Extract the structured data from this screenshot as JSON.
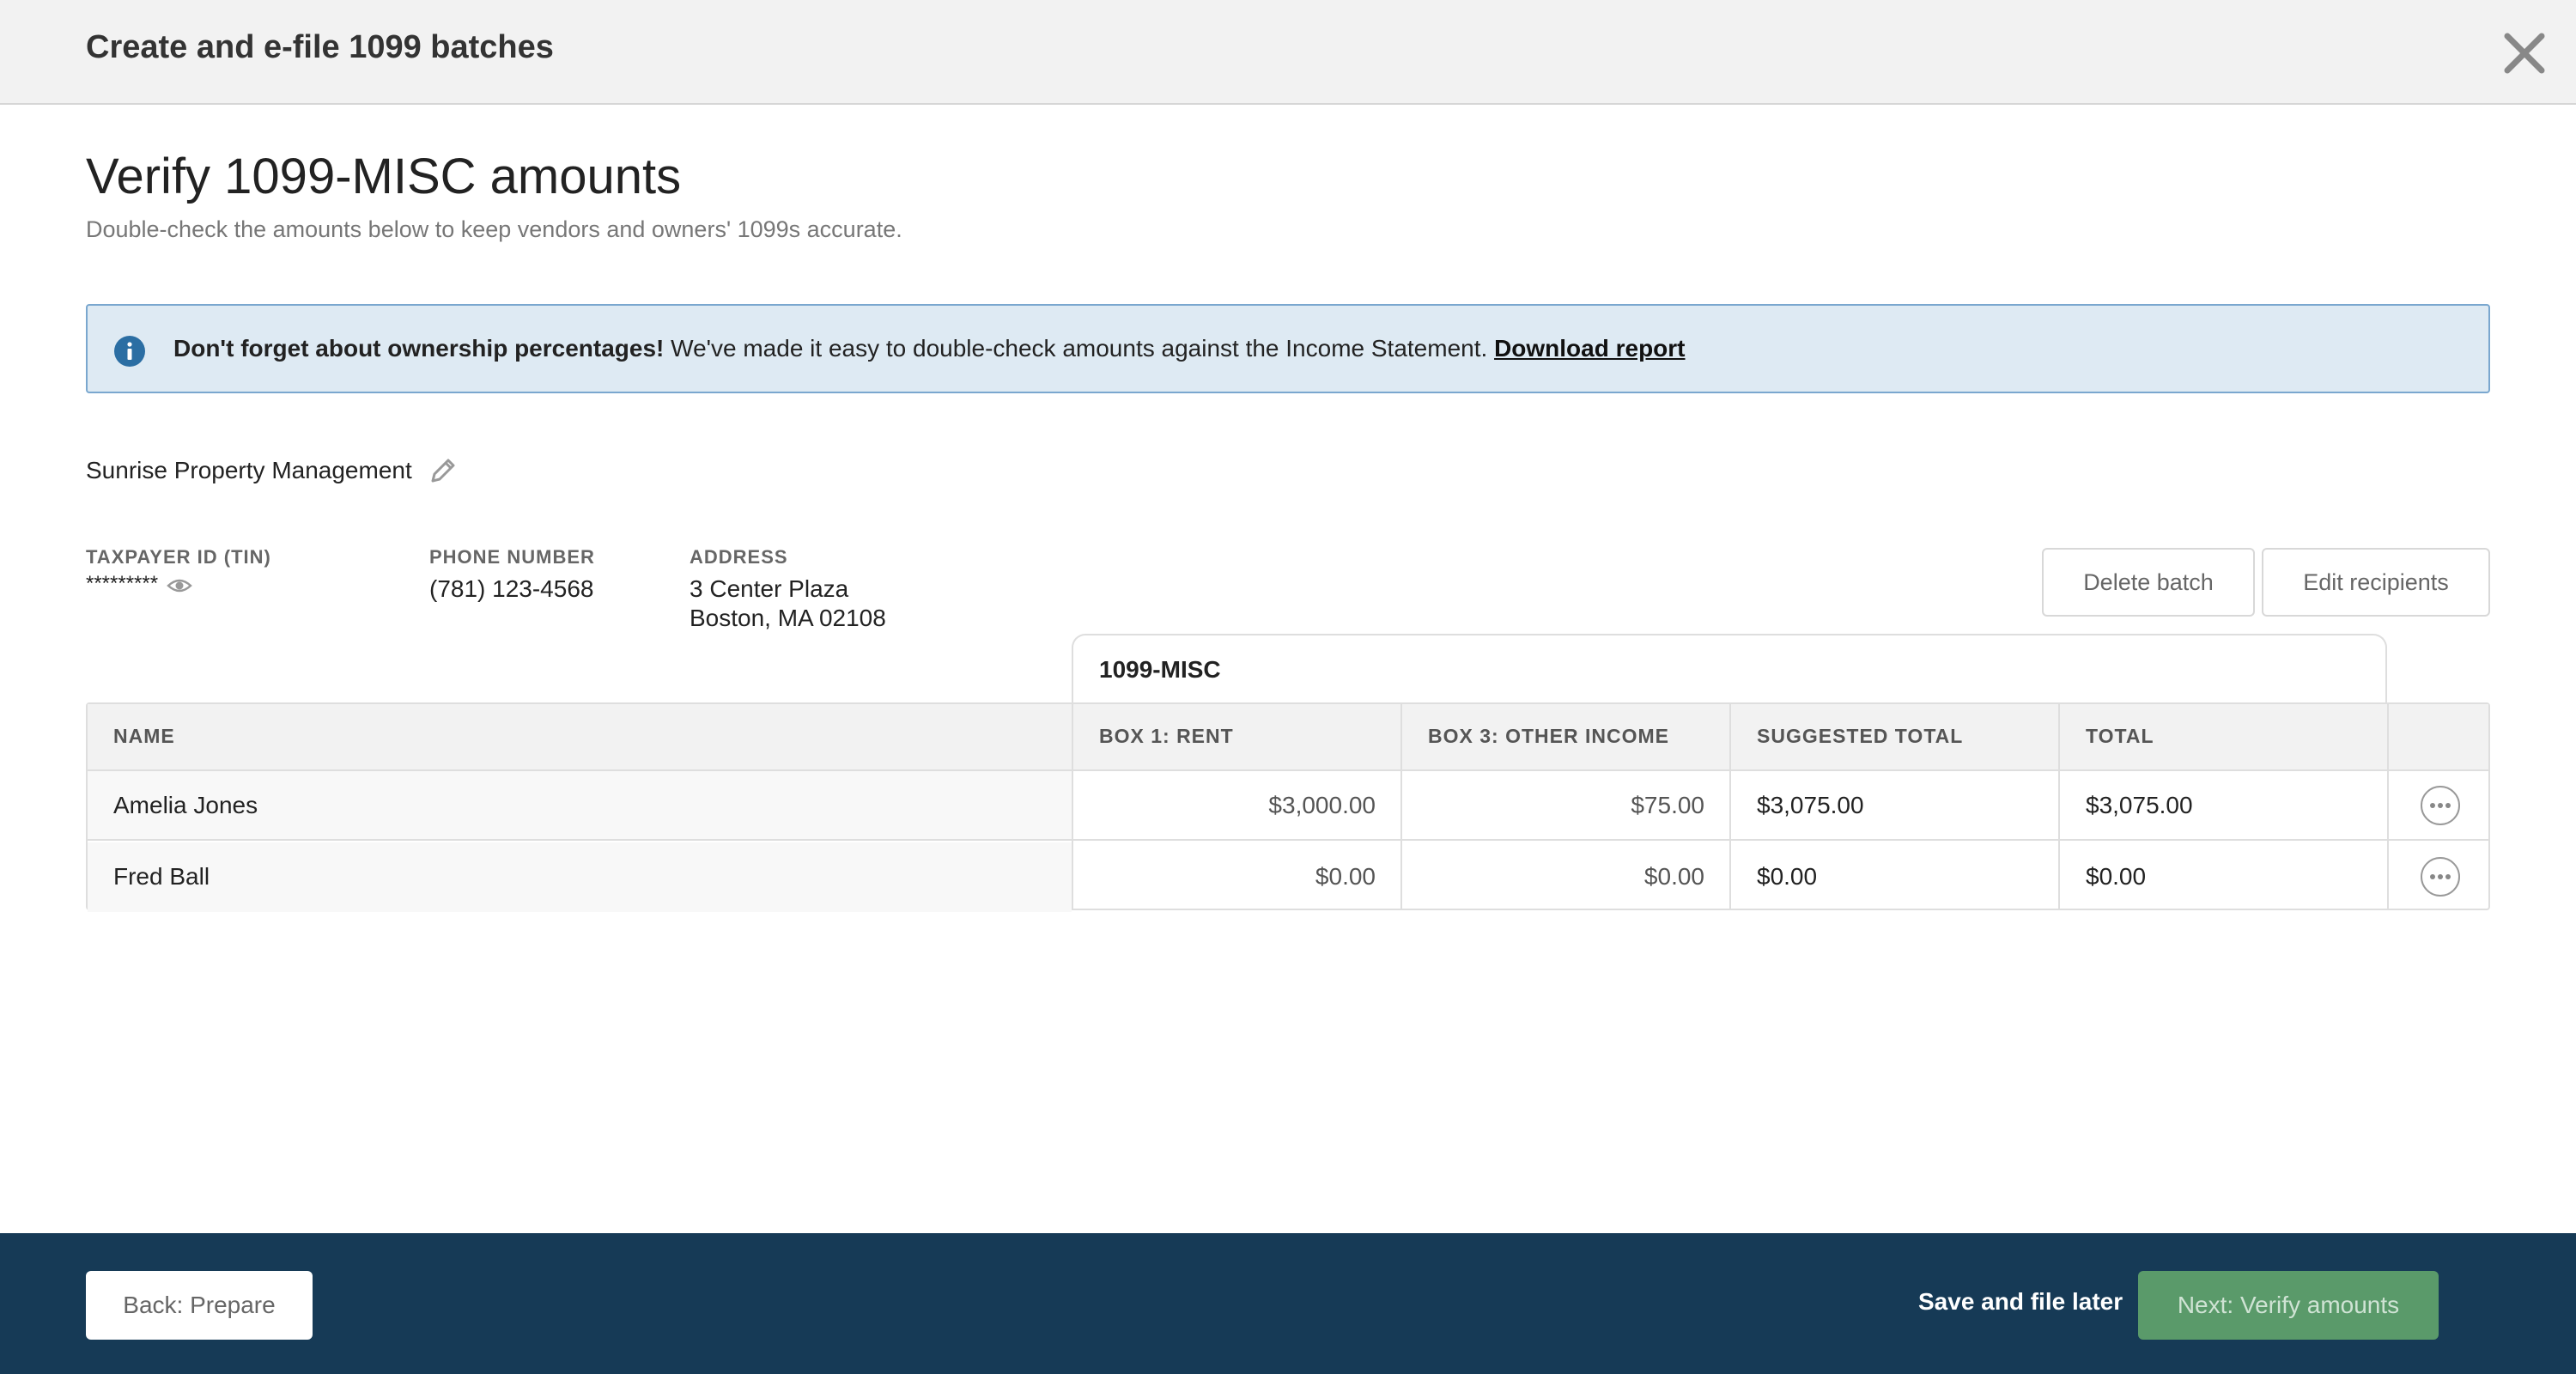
{
  "header": {
    "title": "Create and e-file 1099 batches",
    "close_icon": "close-icon"
  },
  "page": {
    "title": "Verify 1099-MISC amounts",
    "subtitle": "Double-check the amounts below to keep vendors and owners' 1099s accurate."
  },
  "alert": {
    "icon": "info-icon",
    "bold_text": "Don't forget about ownership percentages!",
    "text": " We've made it easy to double-check amounts against the Income Statement. ",
    "link_text": "Download report",
    "color": "#deeaf3"
  },
  "company": {
    "name": "Sunrise Property Management",
    "edit_icon": "pencil-icon",
    "tin_label": "TAXPAYER ID (TIN)",
    "tin_value": "*********",
    "phone_label": "PHONE NUMBER",
    "phone_value": "(781) 123-4568",
    "address_label": "ADDRESS",
    "address_line1": "3 Center Plaza",
    "address_line2": "Boston, MA 02108"
  },
  "actions": {
    "delete_batch": "Delete batch",
    "edit_recipients": "Edit recipients"
  },
  "table": {
    "group_label": "1099-MISC",
    "columns": [
      "NAME",
      "BOX 1: RENT",
      "BOX 3: OTHER INCOME",
      "SUGGESTED TOTAL",
      "TOTAL"
    ],
    "rows": [
      {
        "name": "Amelia Jones",
        "box1": "$3,000.00",
        "box3": "$75.00",
        "suggested": "$3,075.00",
        "total": "$3,075.00"
      },
      {
        "name": "Fred Ball",
        "box1": "$0.00",
        "box3": "$0.00",
        "suggested": "$0.00",
        "total": "$0.00"
      }
    ]
  },
  "footer": {
    "back_label": "Back: Prepare",
    "save_later_label": "Save and file later",
    "next_label": "Next: Verify amounts",
    "background": "#163a56",
    "next_color": "#5a9a6a"
  }
}
